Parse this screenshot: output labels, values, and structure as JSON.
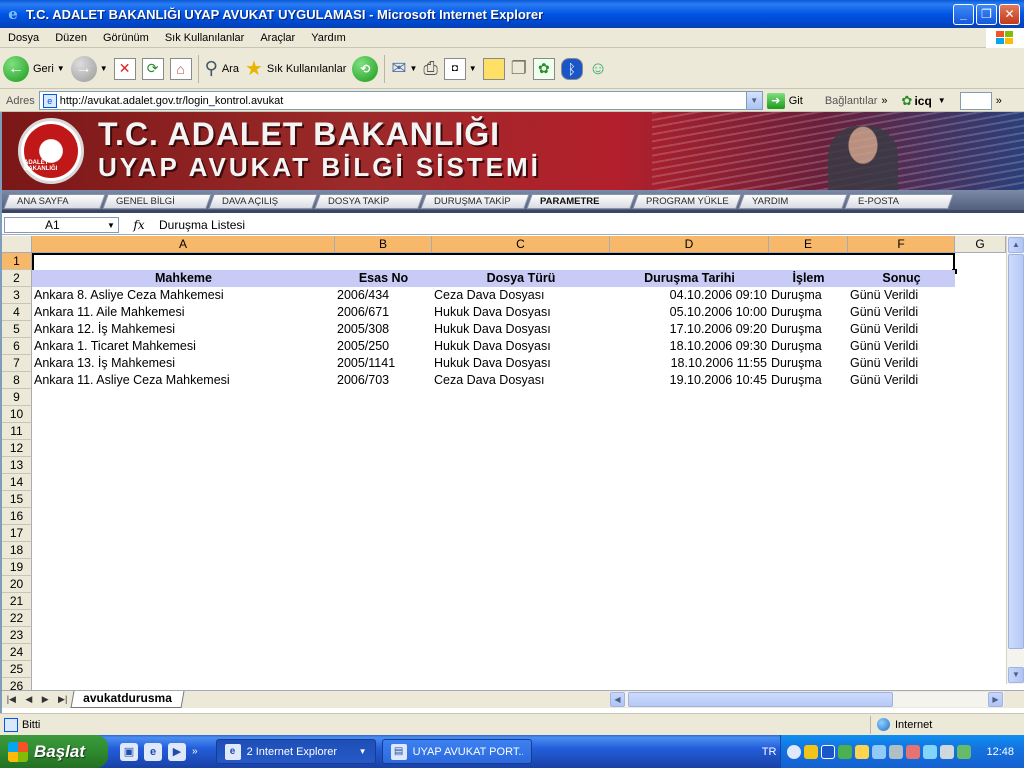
{
  "window": {
    "title": "T.C. ADALET BAKANLIĞI UYAP AVUKAT UYGULAMASI - Microsoft Internet Explorer",
    "buttons": {
      "minimize": "_",
      "maximize": "❐",
      "close": "✕"
    }
  },
  "menu": [
    "Dosya",
    "Düzen",
    "Görünüm",
    "Sık Kullanılanlar",
    "Araçlar",
    "Yardım"
  ],
  "toolbar": {
    "back_label": "Geri",
    "search_label": "Ara",
    "favorites_label": "Sık Kullanılanlar"
  },
  "address": {
    "label": "Adres",
    "url": "http://avukat.adalet.gov.tr/login_kontrol.avukat",
    "go_label": "Git",
    "links_label": "Bağlantılar",
    "icq_label": "icq"
  },
  "banner": {
    "title_line1": "T.C. ADALET BAKANLIĞI",
    "title_line2": "UYAP AVUKAT BİLGİ SİSTEMİ",
    "emblem_text": "ADALET BAKANLIĞI"
  },
  "nav_tabs": [
    "ANA SAYFA",
    "GENEL BİLGİ",
    "DAVA AÇILIŞ",
    "DOSYA TAKİP",
    "DURUŞMA TAKİP",
    "PARAMETRE",
    "PROGRAM YÜKLE",
    "YARDIM",
    "E-POSTA"
  ],
  "spreadsheet": {
    "name_box": "A1",
    "fx_symbol": "fx",
    "formula_value": "Duruşma Listesi",
    "columns": [
      "A",
      "B",
      "C",
      "D",
      "E",
      "F",
      "G"
    ],
    "row_numbers": [
      "1",
      "2",
      "3",
      "4",
      "5",
      "6",
      "7",
      "8",
      "9",
      "10",
      "11",
      "12",
      "13",
      "14",
      "15",
      "16",
      "17",
      "18",
      "19",
      "20",
      "21",
      "22",
      "23",
      "24",
      "25",
      "26"
    ],
    "header_row": [
      "Mahkeme",
      "Esas No",
      "Dosya Türü",
      "Duruşma Tarihi",
      "İşlem",
      "Sonuç"
    ],
    "rows": [
      [
        "Ankara 8. Asliye Ceza Mahkemesi",
        "2006/434",
        "Ceza Dava Dosyası",
        "04.10.2006 09:10",
        "Duruşma",
        "Günü Verildi"
      ],
      [
        "Ankara 11. Aile Mahkemesi",
        "2006/671",
        "Hukuk Dava Dosyası",
        "05.10.2006 10:00",
        "Duruşma",
        "Günü Verildi"
      ],
      [
        "Ankara 12. İş Mahkemesi",
        "2005/308",
        "Hukuk Dava Dosyası",
        "17.10.2006 09:20",
        "Duruşma",
        "Günü Verildi"
      ],
      [
        "Ankara 1. Ticaret Mahkemesi",
        "2005/250",
        "Hukuk Dava Dosyası",
        "18.10.2006 09:30",
        "Duruşma",
        "Günü Verildi"
      ],
      [
        "Ankara 13. İş Mahkemesi",
        "2005/1141",
        "Hukuk Dava Dosyası",
        "18.10.2006 11:55",
        "Duruşma",
        "Günü Verildi"
      ],
      [
        "Ankara 11. Asliye Ceza Mahkemesi",
        "2006/703",
        "Ceza Dava Dosyası",
        "19.10.2006 10:45",
        "Duruşma",
        "Günü Verildi"
      ]
    ],
    "sheet_tab": "avukatdurusma"
  },
  "status": {
    "text": "Bitti",
    "zone": "Internet"
  },
  "taskbar": {
    "start_label": "Başlat",
    "tasks": [
      "2 Internet Explorer",
      "UYAP AVUKAT PORT..."
    ],
    "language": "TR",
    "clock": "12:48"
  },
  "colors": {
    "titlebar": "#0055e5",
    "column_header": "#f7b86a",
    "table_header_bg": "#c7cbf5",
    "banner_red": "#9c2a2a",
    "start_green": "#2f8a2f"
  }
}
